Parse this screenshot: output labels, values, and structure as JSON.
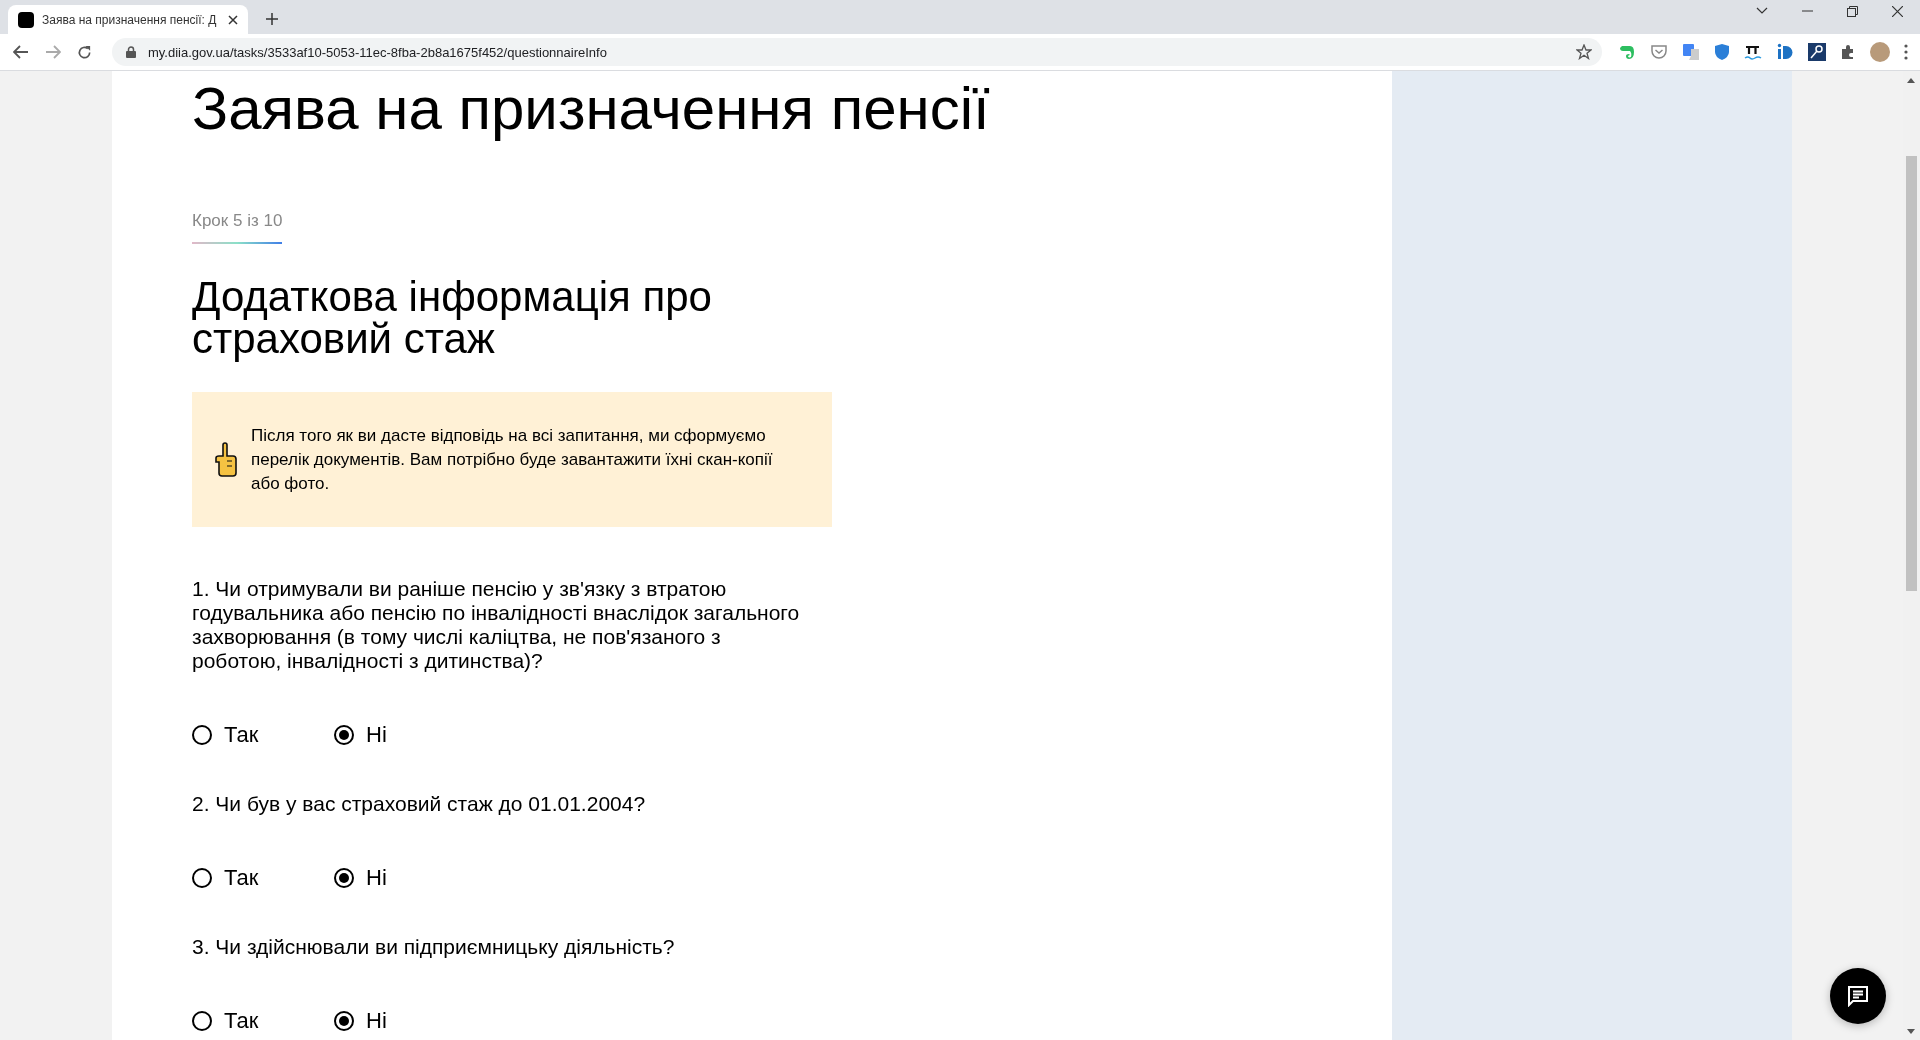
{
  "browser": {
    "tab": {
      "title": "Заява на призначення пенсії: Д",
      "selected": true
    },
    "address": "my.diia.gov.ua/tasks/3533af10-5053-11ec-8fba-2b8a1675f452/questionnaireInfo"
  },
  "page": {
    "title": "Заява на призначення пенсії",
    "step": "Крок 5 із 10",
    "heading": "Додаткова інформація про страховий стаж",
    "notice": "Після того як ви дасте відповідь на всі запитання, ми сформуємо перелік документів. Вам потрібно буде завантажити їхні скан-копії або фото.",
    "questions": [
      {
        "text": "1. Чи отримували ви раніше пенсію у зв'язку з втратою годувальника або пенсію по інвалідності внаслідок загального захворювання (в тому числі каліцтва, не пов'язаного з роботою, інвалідності з дитинства)?",
        "options": [
          {
            "label": "Так",
            "selected": false
          },
          {
            "label": "Ні",
            "selected": true
          }
        ]
      },
      {
        "text": "2. Чи був у вас страховий стаж до 01.01.2004?",
        "options": [
          {
            "label": "Так",
            "selected": false
          },
          {
            "label": "Ні",
            "selected": true
          }
        ]
      },
      {
        "text": "3. Чи здійснювали ви підприємницьку діяльність?",
        "options": [
          {
            "label": "Так",
            "selected": false
          },
          {
            "label": "Ні",
            "selected": true
          }
        ]
      }
    ]
  }
}
